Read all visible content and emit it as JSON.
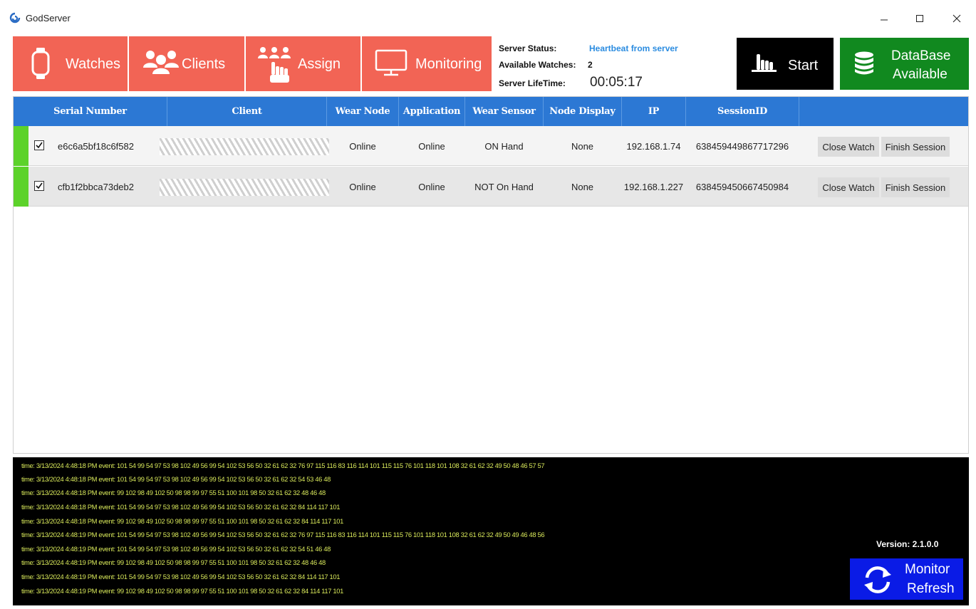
{
  "window": {
    "title": "GodServer",
    "controls": [
      "minimize",
      "maximize",
      "close"
    ]
  },
  "nav": {
    "watches": "Watches",
    "clients": "Clients",
    "assign": "Assign",
    "monitoring": "Monitoring",
    "color": "#f26455"
  },
  "status": {
    "server_status_label": "Server Status:",
    "server_status_value": "Heartbeat from server",
    "available_watches_label": "Available Watches:",
    "available_watches_value": "2",
    "lifetime_label": "Server LifeTime:",
    "lifetime_value": "00:05:17"
  },
  "actions": {
    "start": "Start",
    "db_line1": "DataBase",
    "db_line2": "Available",
    "db_color": "#11891f"
  },
  "table": {
    "header_color": "#2c78d4",
    "columns": [
      "Serial Number",
      "Client",
      "Wear Node",
      "Application",
      "Wear Sensor",
      "Node Display",
      "IP",
      "SessionID",
      ""
    ],
    "rows": [
      {
        "checked": true,
        "serial": "e6c6a5bf18c6f582",
        "wear_node": "Online",
        "application": "Online",
        "wear_sensor": "ON Hand",
        "node_display": "None",
        "ip": "192.168.1.74",
        "session_id": "638459449867717296",
        "close_label": "Close Watch",
        "finish_label": "Finish Session"
      },
      {
        "checked": true,
        "serial": "cfb1f2bbca73deb2",
        "wear_node": "Online",
        "application": "Online",
        "wear_sensor": "NOT On Hand",
        "node_display": "None",
        "ip": "192.168.1.227",
        "session_id": "638459450667450984",
        "close_label": "Close Watch",
        "finish_label": "Finish Session"
      }
    ]
  },
  "log": {
    "lines": [
      "time: 3/13/2024 4:48:18 PM event: 101 54 99 54 97 53 98 102 49 56 99 54 102 53 56 50 32 61 62 32 76 97 115 116 83 116 114 101 115 115 76 101 118 101 108 32 61 62 32 49 50 48 46 57 57",
      "time: 3/13/2024 4:48:18 PM event: 101 54 99 54 97 53 98 102 49 56 99 54 102 53 56 50 32 61 62 32 54 53 46 48",
      "time: 3/13/2024 4:48:18 PM event: 99 102 98 49 102 50 98 98 99 97 55 51 100 101 98 50 32 61 62 32 48 46 48",
      "time: 3/13/2024 4:48:18 PM event: 101 54 99 54 97 53 98 102 49 56 99 54 102 53 56 50 32 61 62 32 84 114 117 101",
      "time: 3/13/2024 4:48:18 PM event: 99 102 98 49 102 50 98 98 99 97 55 51 100 101 98 50 32 61 62 32 84 114 117 101",
      "time: 3/13/2024 4:48:19 PM event: 101 54 99 54 97 53 98 102 49 56 99 54 102 53 56 50 32 61 62 32 76 97 115 116 83 116 114 101 115 115 76 101 118 101 108 32 61 62 32 49 50 49 46 48 56",
      "time: 3/13/2024 4:48:19 PM event: 101 54 99 54 97 53 98 102 49 56 99 54 102 53 56 50 32 61 62 32 54 51 46 48",
      "time: 3/13/2024 4:48:19 PM event: 99 102 98 49 102 50 98 98 99 97 55 51 100 101 98 50 32 61 62 32 48 46 48",
      "time: 3/13/2024 4:48:19 PM event: 101 54 99 54 97 53 98 102 49 56 99 54 102 53 56 50 32 61 62 32 84 114 117 101",
      "time: 3/13/2024 4:48:19 PM event: 99 102 98 49 102 50 98 98 99 97 55 51 100 101 98 50 32 61 62 32 84 114 117 101"
    ],
    "text_color": "#d8e85a"
  },
  "footer": {
    "version": "Version: 2.1.0.0",
    "monitor_line1": "Monitor",
    "monitor_line2": "Refresh",
    "monitor_color": "#0a1be6"
  }
}
